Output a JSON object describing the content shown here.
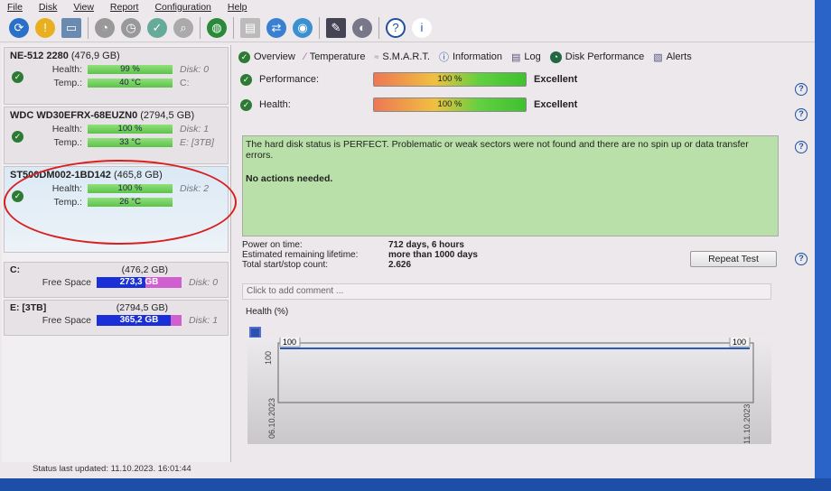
{
  "menu": [
    "File",
    "Disk",
    "View",
    "Report",
    "Configuration",
    "Help"
  ],
  "disks": [
    {
      "name": "NE-512 2280",
      "size": "(476,9 GB)",
      "health": "99 %",
      "temp": "40 °C",
      "disk": "Disk: 0",
      "extra": "C:"
    },
    {
      "name": "WDC WD30EFRX-68EUZN0",
      "size": "(2794,5 GB)",
      "health": "100 %",
      "temp": "33 °C",
      "disk": "Disk: 1",
      "extra": "E: [3TB]"
    },
    {
      "name": "ST500DM002-1BD142",
      "size": "(465,8 GB)",
      "health": "100 %",
      "temp": "26 °C",
      "disk": "Disk: 2",
      "extra": ""
    }
  ],
  "labels": {
    "health": "Health:",
    "temp": "Temp.:",
    "free": "Free Space"
  },
  "volumes": [
    {
      "name": "C:",
      "size": "(476,2 GB)",
      "free": "273,3 GB",
      "free_fraction": 0.57,
      "disk": "Disk: 0"
    },
    {
      "name": "E: [3TB]",
      "size": "(2794,5 GB)",
      "free": "365,2 GB",
      "free_fraction": 0.87,
      "disk": "Disk: 1"
    }
  ],
  "tabs": [
    "Overview",
    "Temperature",
    "S.M.A.R.T.",
    "Information",
    "Log",
    "Disk Performance",
    "Alerts"
  ],
  "performance": {
    "label": "Performance:",
    "value": "100 %",
    "rating": "Excellent"
  },
  "health": {
    "label": "Health:",
    "value": "100 %",
    "rating": "Excellent"
  },
  "status_text": "The hard disk status is PERFECT. Problematic or weak sectors were not found and there are no spin up or data transfer errors.",
  "actions_text": "No actions needed.",
  "info": [
    {
      "k": "Power on time:",
      "v": "712 days, 6 hours"
    },
    {
      "k": "Estimated remaining lifetime:",
      "v": "more than 1000 days"
    },
    {
      "k": "Total start/stop count:",
      "v": "2.626"
    }
  ],
  "repeat_test": "Repeat Test",
  "comment_placeholder": "Click to add comment ...",
  "chart_tab": "Health (%)",
  "chart_data": {
    "type": "line",
    "title": "Health (%)",
    "x": [
      "06.10.2023",
      "11.10.2023"
    ],
    "values": [
      100,
      100
    ],
    "y_tick": "100",
    "ylim": [
      0,
      100
    ]
  },
  "statusbar": "Status last updated: 11.10.2023. 16:01:44"
}
